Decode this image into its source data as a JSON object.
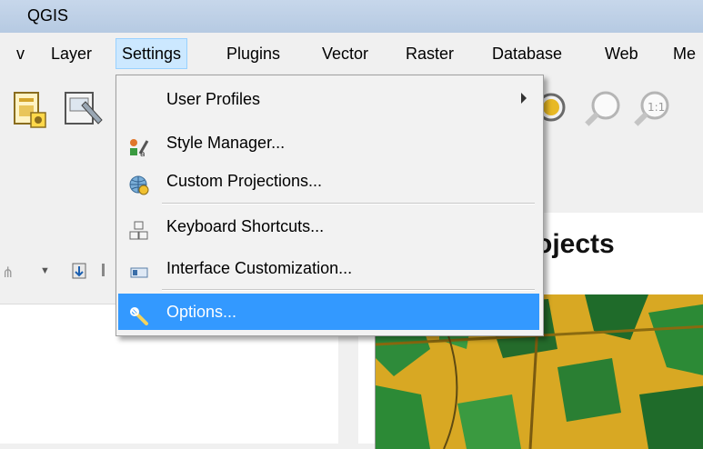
{
  "window": {
    "title": "QGIS"
  },
  "menubar": {
    "items": [
      {
        "label": "v"
      },
      {
        "label": "Layer"
      },
      {
        "label": "Settings"
      },
      {
        "label": "Plugins"
      },
      {
        "label": "Vector"
      },
      {
        "label": "Raster"
      },
      {
        "label": "Database"
      },
      {
        "label": "Web"
      },
      {
        "label": "Me"
      }
    ]
  },
  "settings_menu": {
    "items": [
      {
        "label": "User Profiles",
        "icon": "none",
        "has_submenu": true
      },
      {
        "label": "Style Manager...",
        "icon": "style-manager-icon"
      },
      {
        "label": "Custom Projections...",
        "icon": "custom-projections-icon"
      },
      {
        "label": "Keyboard Shortcuts...",
        "icon": "keyboard-shortcuts-icon"
      },
      {
        "label": "Interface Customization...",
        "icon": "interface-customization-icon"
      },
      {
        "label": "Options...",
        "icon": "wrench-icon",
        "highlighted": true
      }
    ]
  },
  "main": {
    "projects_heading": "ojects"
  },
  "colors": {
    "highlight": "#3399ff",
    "menu_active_bg": "#cce8ff",
    "titlebar": "#bfd1e8"
  }
}
